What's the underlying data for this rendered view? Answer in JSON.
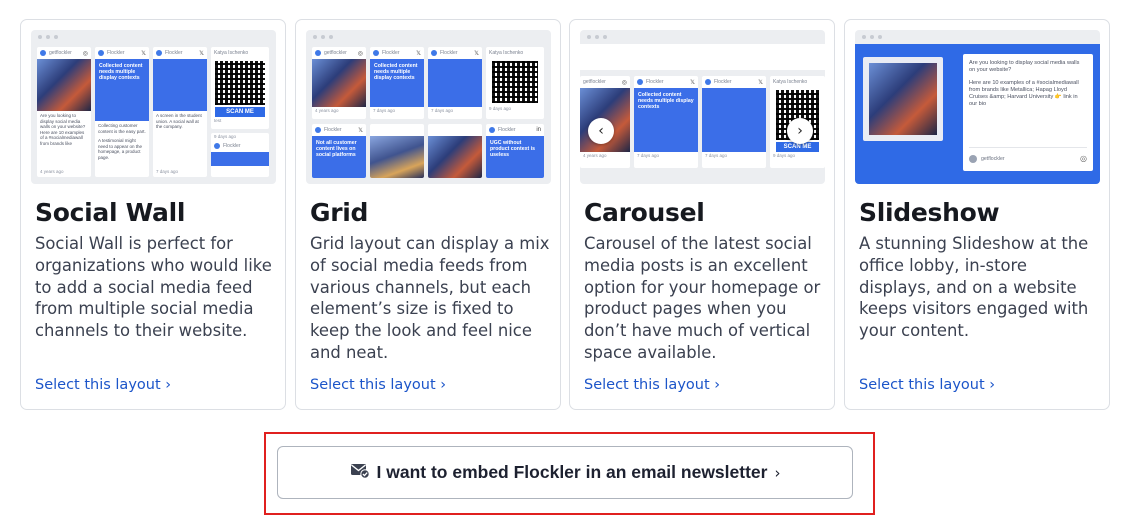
{
  "layouts": [
    {
      "title": "Social Wall",
      "description": "Social Wall is perfect for organizations who would like to add a social media feed from multiple social media channels to their website.",
      "link": "Select this layout ›",
      "preview": {
        "names": [
          "getflockler",
          "Flockler",
          "Flockler",
          "Katya Ischenko"
        ],
        "blue_text": "Collected content needs multiple display contexts",
        "post_text": "Are you looking to display social media walls on your website? Here are 10 examples of a #socialmediawall from brands like",
        "post_text2": "Collecting customer content is the easy part.",
        "post_text3": "A screen in the student union. A social wall at the company.",
        "post_text4": "A testimonial might need to appear on the homepage, a product page.",
        "ages": [
          "4 years ago",
          "7 days ago",
          "7 days ago",
          "9 days ago"
        ],
        "scan": "SCAN ME",
        "qr_label": "test"
      }
    },
    {
      "title": "Grid",
      "description": "Grid layout can display a mix of social media feeds from various channels, but each element’s size is fixed to keep the look and feel nice and neat.",
      "link": "Select this layout ›",
      "preview": {
        "names": [
          "getflockler",
          "Flockler",
          "Flockler",
          "Katya Ischenko"
        ],
        "blue_text": "Collected content needs multiple display contexts",
        "blue_text2": "Not all customer content lives on social platforms",
        "blue_text3": "UGC without product context is useless",
        "ages": [
          "4 years ago",
          "7 days ago",
          "7 days ago",
          "9 days ago"
        ]
      }
    },
    {
      "title": "Carousel",
      "description": "Carousel of the latest social media posts is an excellent option for your homepage or product pages when you don’t have much of vertical space available.",
      "link": "Select this layout ›",
      "preview": {
        "names": [
          "getflockler",
          "Flockler",
          "Flockler",
          "Katya Ischenko"
        ],
        "blue_text": "Collected content needs multiple display contexts",
        "ages": [
          "4 years ago",
          "7 days ago",
          "7 days ago",
          "9 days ago"
        ],
        "scan": "SCAN ME",
        "prev": "‹",
        "next": "›"
      }
    },
    {
      "title": "Slideshow",
      "description": "A stunning Slideshow at the office lobby, in-store displays, and on a website keeps visitors engaged with your content.",
      "link": "Select this layout ›",
      "preview": {
        "post_text": "Are you looking to display social media walls on your website?",
        "post_text2": "Here are 10 examples of a #socialmediawall from brands like Metallica; Hapag Lloyd Cruises &amp; Harvard University 👉 link in our bio",
        "name": "getflockler"
      }
    }
  ],
  "newsletter": {
    "label": "I want to embed Flockler in an email newsletter",
    "chevron": "›"
  },
  "colors": {
    "accent_blue": "#2f6ae6",
    "link_blue": "#1c55c9",
    "highlight_red": "#e0201f"
  }
}
